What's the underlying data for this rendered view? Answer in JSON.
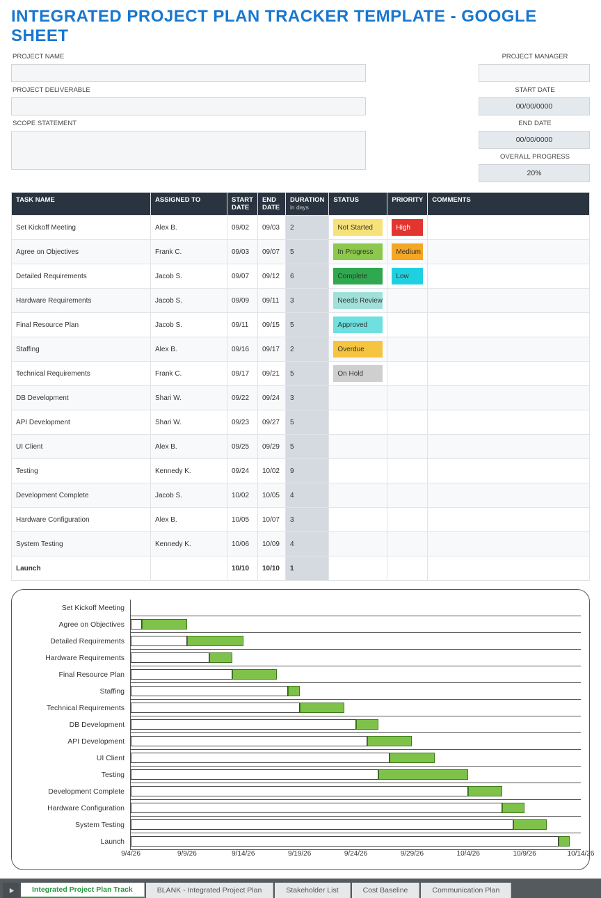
{
  "title": "INTEGRATED PROJECT PLAN TRACKER TEMPLATE - GOOGLE SHEET",
  "header": {
    "labels": {
      "project_name": "PROJECT NAME",
      "project_manager": "PROJECT MANAGER",
      "project_deliverable": "PROJECT DELIVERABLE",
      "start_date": "START DATE",
      "scope_statement": "SCOPE STATEMENT",
      "end_date": "END DATE",
      "overall_progress": "OVERALL PROGRESS"
    },
    "values": {
      "start_date": "00/00/0000",
      "end_date": "00/00/0000",
      "overall_progress": "20%"
    }
  },
  "columns": {
    "task_name": "TASK NAME",
    "assigned_to": "ASSIGNED TO",
    "start_date": "START DATE",
    "end_date": "END DATE",
    "duration": "DURATION",
    "duration_sub": "in days",
    "status": "STATUS",
    "priority": "PRIORITY",
    "comments": "COMMENTS"
  },
  "status_colors": {
    "Not Started": "#f7e27a",
    "In Progress": "#8cc84b",
    "Complete": "#2fa84f",
    "Needs Review": "#9fe1da",
    "Approved": "#6ee0e0",
    "Overdue": "#f5c542",
    "On Hold": "#cfcfcf"
  },
  "priority_colors": {
    "High": "#e3342f",
    "Medium": "#f5a623",
    "Low": "#1fd1e0"
  },
  "tasks": [
    {
      "name": "Set Kickoff Meeting",
      "assigned": "Alex B.",
      "start": "09/02",
      "end": "09/03",
      "dur": "2",
      "status": "Not Started",
      "priority": "High"
    },
    {
      "name": "Agree on Objectives",
      "assigned": "Frank C.",
      "start": "09/03",
      "end": "09/07",
      "dur": "5",
      "status": "In Progress",
      "priority": "Medium"
    },
    {
      "name": "Detailed Requirements",
      "assigned": "Jacob S.",
      "start": "09/07",
      "end": "09/12",
      "dur": "6",
      "status": "Complete",
      "priority": "Low"
    },
    {
      "name": "Hardware Requirements",
      "assigned": "Jacob S.",
      "start": "09/09",
      "end": "09/11",
      "dur": "3",
      "status": "Needs Review",
      "priority": ""
    },
    {
      "name": "Final Resource Plan",
      "assigned": "Jacob S.",
      "start": "09/11",
      "end": "09/15",
      "dur": "5",
      "status": "Approved",
      "priority": ""
    },
    {
      "name": "Staffing",
      "assigned": "Alex B.",
      "start": "09/16",
      "end": "09/17",
      "dur": "2",
      "status": "Overdue",
      "priority": ""
    },
    {
      "name": "Technical Requirements",
      "assigned": "Frank C.",
      "start": "09/17",
      "end": "09/21",
      "dur": "5",
      "status": "On Hold",
      "priority": ""
    },
    {
      "name": "DB Development",
      "assigned": "Shari W.",
      "start": "09/22",
      "end": "09/24",
      "dur": "3",
      "status": "",
      "priority": ""
    },
    {
      "name": "API Development",
      "assigned": "Shari W.",
      "start": "09/23",
      "end": "09/27",
      "dur": "5",
      "status": "",
      "priority": ""
    },
    {
      "name": "UI Client",
      "assigned": "Alex B.",
      "start": "09/25",
      "end": "09/29",
      "dur": "5",
      "status": "",
      "priority": ""
    },
    {
      "name": "Testing",
      "assigned": "Kennedy K.",
      "start": "09/24",
      "end": "10/02",
      "dur": "9",
      "status": "",
      "priority": ""
    },
    {
      "name": "Development Complete",
      "assigned": "Jacob S.",
      "start": "10/02",
      "end": "10/05",
      "dur": "4",
      "status": "",
      "priority": ""
    },
    {
      "name": "Hardware Configuration",
      "assigned": "Alex B.",
      "start": "10/05",
      "end": "10/07",
      "dur": "3",
      "status": "",
      "priority": ""
    },
    {
      "name": "System Testing",
      "assigned": "Kennedy K.",
      "start": "10/06",
      "end": "10/09",
      "dur": "4",
      "status": "",
      "priority": ""
    },
    {
      "name": "Launch",
      "assigned": "",
      "start": "10/10",
      "end": "10/10",
      "dur": "1",
      "status": "",
      "priority": "",
      "bold": true
    }
  ],
  "chart_data": {
    "type": "bar",
    "title": "",
    "x_axis": {
      "min_day": 2,
      "max_day": 42,
      "ticks": [
        "9/4/26",
        "9/9/26",
        "9/14/26",
        "9/19/26",
        "9/24/26",
        "9/29/26",
        "10/4/26",
        "10/9/26",
        "10/14/26"
      ],
      "tick_days": [
        2,
        7,
        12,
        17,
        22,
        27,
        32,
        37,
        42
      ]
    },
    "categories": [
      "Set Kickoff Meeting",
      "Agree on Objectives",
      "Detailed Requirements",
      "Hardware Requirements",
      "Final Resource Plan",
      "Staffing",
      "Technical Requirements",
      "DB Development",
      "API Development",
      "UI Client",
      "Testing",
      "Development Complete",
      "Hardware Configuration",
      "System Testing",
      "Launch"
    ],
    "series": [
      {
        "name": "lead",
        "comment": "white portion start-day and length (days from 9/2 baseline=0)",
        "values": [
          {
            "start": 0,
            "len": 0
          },
          {
            "start": 0,
            "len": 1
          },
          {
            "start": 0,
            "len": 5
          },
          {
            "start": 0,
            "len": 7
          },
          {
            "start": 0,
            "len": 9
          },
          {
            "start": 0,
            "len": 14
          },
          {
            "start": 0,
            "len": 15
          },
          {
            "start": 0,
            "len": 20
          },
          {
            "start": 0,
            "len": 21
          },
          {
            "start": 0,
            "len": 23
          },
          {
            "start": 0,
            "len": 22
          },
          {
            "start": 0,
            "len": 30
          },
          {
            "start": 0,
            "len": 33
          },
          {
            "start": 0,
            "len": 34
          },
          {
            "start": 0,
            "len": 38
          }
        ]
      },
      {
        "name": "duration",
        "comment": "green portion start-day and length",
        "values": [
          {
            "start": 0,
            "len": 0
          },
          {
            "start": 1,
            "len": 4
          },
          {
            "start": 5,
            "len": 5
          },
          {
            "start": 7,
            "len": 2
          },
          {
            "start": 9,
            "len": 4
          },
          {
            "start": 14,
            "len": 1
          },
          {
            "start": 15,
            "len": 4
          },
          {
            "start": 20,
            "len": 2
          },
          {
            "start": 21,
            "len": 4
          },
          {
            "start": 23,
            "len": 4
          },
          {
            "start": 22,
            "len": 8
          },
          {
            "start": 30,
            "len": 3
          },
          {
            "start": 33,
            "len": 2
          },
          {
            "start": 34,
            "len": 3
          },
          {
            "start": 38,
            "len": 1
          }
        ]
      }
    ]
  },
  "tabs": [
    {
      "label": "Integrated Project Plan Track",
      "active": true
    },
    {
      "label": "BLANK - Integrated Project Plan",
      "active": false
    },
    {
      "label": "Stakeholder List",
      "active": false
    },
    {
      "label": "Cost Baseline",
      "active": false
    },
    {
      "label": "Communication Plan",
      "active": false
    }
  ]
}
